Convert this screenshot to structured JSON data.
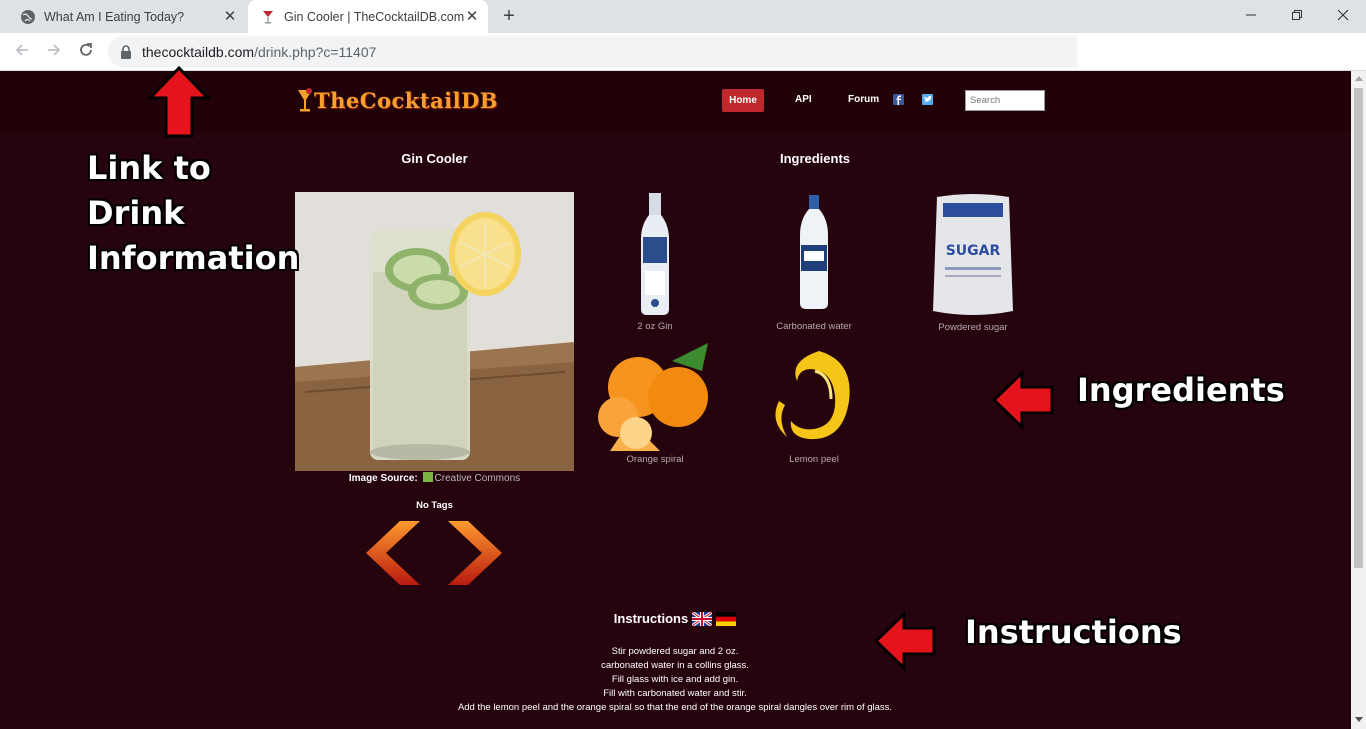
{
  "browser": {
    "tabs": [
      {
        "title": "What Am I Eating Today?",
        "active": false
      },
      {
        "title": "Gin Cooler | TheCocktailDB.com",
        "active": true
      }
    ],
    "new_tab_label": "+",
    "url_domain": "thecocktaildb.com",
    "url_path": "/drink.php?c=11407",
    "window_controls": [
      "minimize",
      "restore",
      "close"
    ]
  },
  "site": {
    "logo_text": "TheCocktailDB",
    "nav": {
      "home": "Home",
      "api": "API",
      "forum": "Forum"
    },
    "search_placeholder": "Search"
  },
  "drink": {
    "name": "Gin Cooler",
    "image_source_label": "Image Source:",
    "image_source_value": "Creative Commons",
    "tags": "No Tags"
  },
  "ingredients": {
    "title": "Ingredients",
    "items": [
      {
        "label": "2 oz Gin"
      },
      {
        "label": "Carbonated water"
      },
      {
        "label": "Powdered sugar"
      },
      {
        "label": "Orange spiral"
      },
      {
        "label": "Lemon peel"
      }
    ]
  },
  "instructions": {
    "title": "Instructions",
    "lines": [
      "Stir powdered sugar and 2 oz.",
      "carbonated water in a collins glass.",
      "Fill glass with ice and add gin.",
      "Fill with carbonated water and stir.",
      "Add the lemon peel and the orange spiral so that the end of the orange spiral dangles over rim of glass."
    ]
  },
  "annotations": {
    "link_label_1": "Link to",
    "link_label_2": "Drink",
    "link_label_3": "Information",
    "ingredients_label": "Ingredients",
    "instructions_label": "Instructions"
  },
  "colors": {
    "page_bg": "#26040e",
    "accent": "#c0282e",
    "logo": "#f5a02c",
    "annotation_arrow": "#e5141c"
  }
}
